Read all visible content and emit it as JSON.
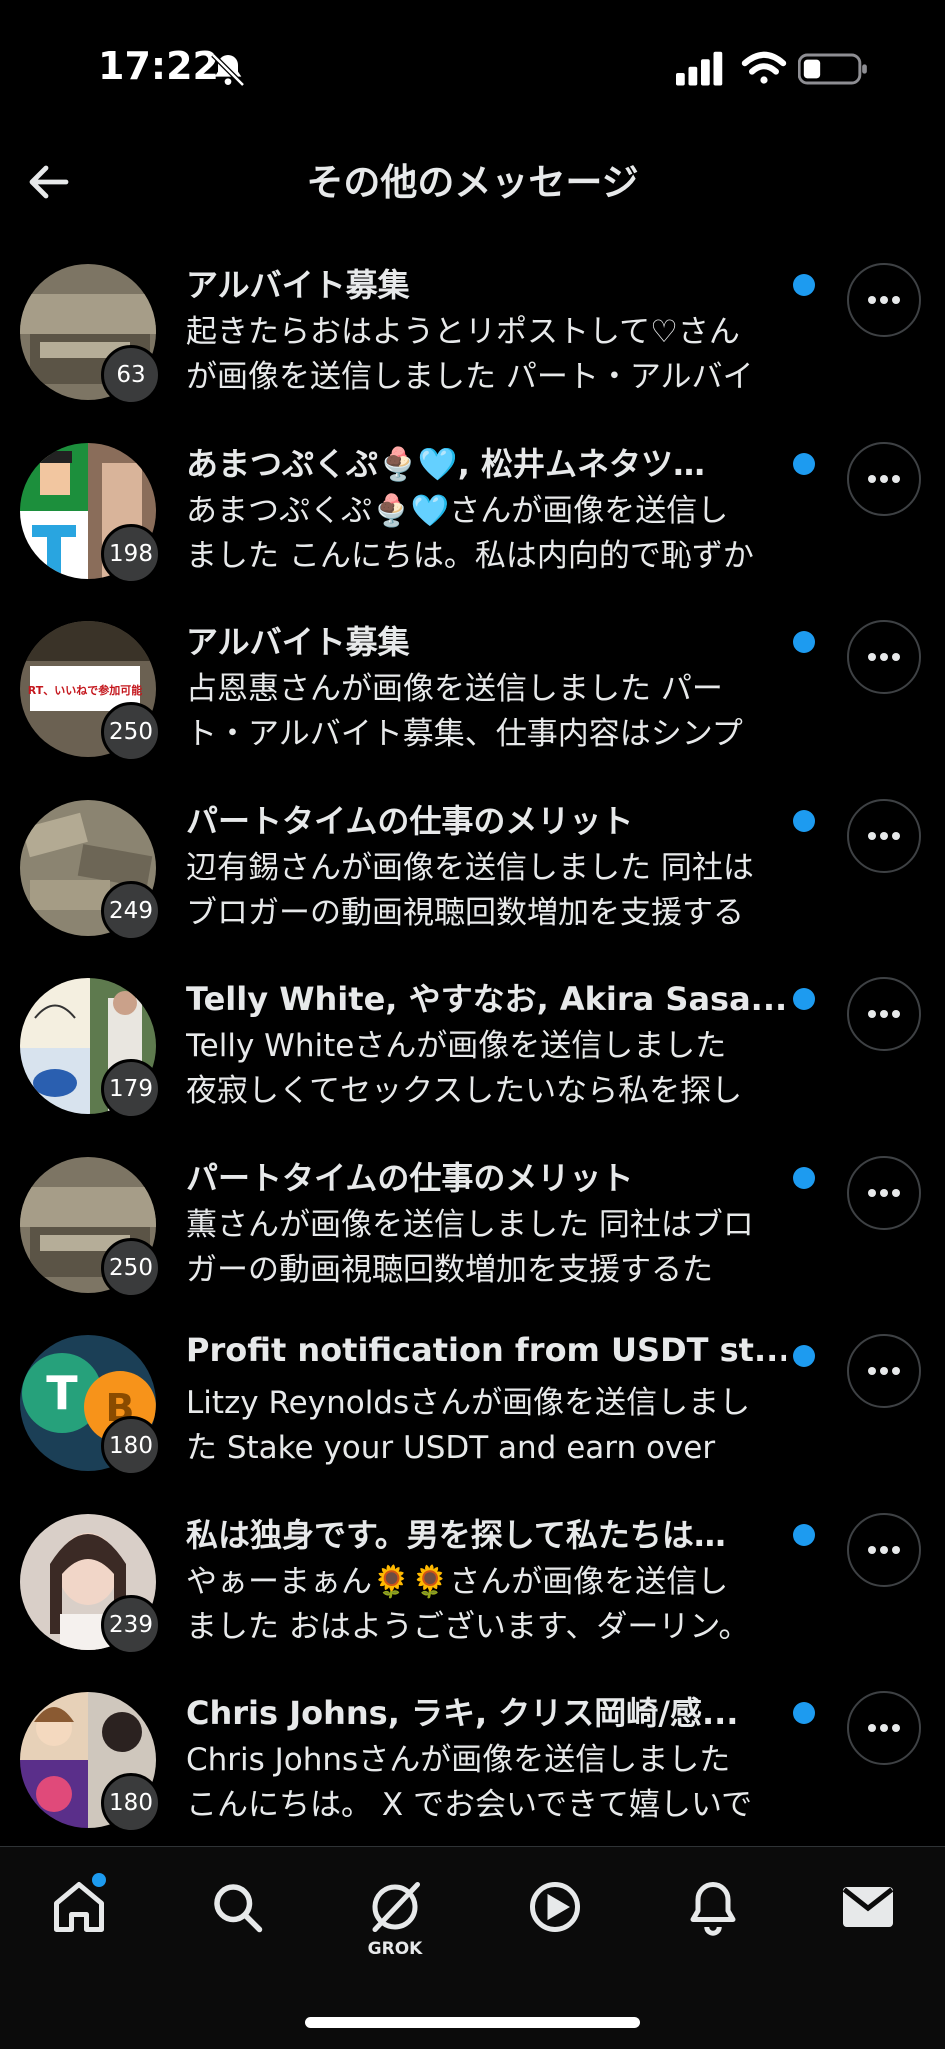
{
  "status_bar": {
    "time": "17:22"
  },
  "header": {
    "title": "その他のメッセージ"
  },
  "conversations": [
    {
      "title": "アルバイト募集",
      "line1": "起きたらおはようとリポストして♡さん",
      "line2": "が画像を送信しました パート・アルバイ",
      "count": "63",
      "unread": true
    },
    {
      "title": "あまつぷくぷ🍨🩵, 松井ムネタツ…",
      "line1": "あまつぷくぷ🍨🩵さんが画像を送信し",
      "line2": "ました こんにちは。私は内向的で恥ずか",
      "count": "198",
      "unread": true
    },
    {
      "title": "アルバイト募集",
      "line1": "占恩惠さんが画像を送信しました パー",
      "line2": "ト・アルバイト募集、仕事内容はシンプ",
      "count": "250",
      "unread": true,
      "avatar_text": "RT、いいねで参加可能"
    },
    {
      "title": "パートタイムの仕事のメリット",
      "line1": "辺有錫さんが画像を送信しました 同社は",
      "line2": "ブロガーの動画視聴回数増加を支援する",
      "count": "249",
      "unread": true
    },
    {
      "title": "Telly White, やすなお, Akira Sasa...",
      "line1": "Telly Whiteさんが画像を送信しました",
      "line2": "夜寂しくてセックスしたいなら私を探し",
      "count": "179",
      "unread": true
    },
    {
      "title": "パートタイムの仕事のメリット",
      "line1": "薫さんが画像を送信しました 同社はブロ",
      "line2": "ガーの動画視聴回数増加を支援するた",
      "count": "250",
      "unread": true
    },
    {
      "title": "Profit notification from USDT st...",
      "line1": "Litzy Reynoldsさんが画像を送信しまし",
      "line2": "た Stake your USDT and earn over",
      "count": "180",
      "unread": true
    },
    {
      "title": "私は独身です。男を探して私たちは…",
      "line1": "やぁーまぁん🌻🌻さんが画像を送信し",
      "line2": "ました おはようございます、ダーリン。",
      "count": "239",
      "unread": true
    },
    {
      "title": "Chris Johns, ラキ, クリス岡崎/感...",
      "line1": "Chris Johnsさんが画像を送信しました",
      "line2": "こんにちは。 X でお会いできて嬉しいで",
      "count": "180",
      "unread": true
    }
  ],
  "tabbar": {
    "grok_label": "GROK"
  },
  "colors": {
    "accent": "#1d9bf0",
    "background": "#000000",
    "text": "#e7e9ea"
  }
}
